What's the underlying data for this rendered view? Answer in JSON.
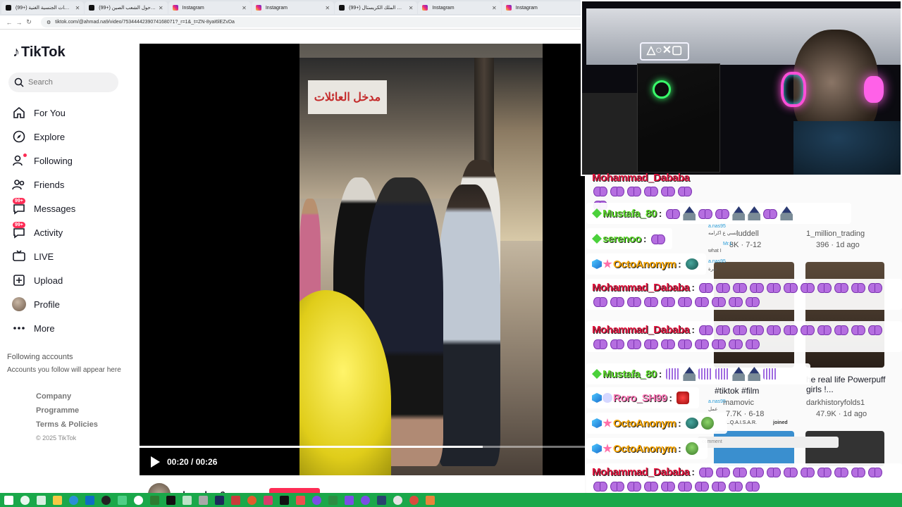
{
  "browser": {
    "tabs": [
      {
        "label": "(99+) السارسات الجنسية الغنية",
        "favicon": "tiktok"
      },
      {
        "label": "(99+) تحليلات حول الشعب الصين",
        "favicon": "tiktok"
      },
      {
        "label": "Instagram",
        "favicon": "instagram"
      },
      {
        "label": "Instagram",
        "favicon": "instagram"
      },
      {
        "label": "(99+) الملك الكريستال @rwafaa",
        "favicon": "tiktok"
      },
      {
        "label": "Instagram",
        "favicon": "instagram"
      },
      {
        "label": "Instagram",
        "favicon": "instagram"
      }
    ],
    "url": "tiktok.com/@ahmad.na9/video/7534444239074168071?_r=1&_t=ZN-8yaI6lEZvDa"
  },
  "tiktok": {
    "logo": "TikTok",
    "search_placeholder": "Search",
    "nav": [
      {
        "label": "For You",
        "icon": "home-icon"
      },
      {
        "label": "Explore",
        "icon": "compass-icon"
      },
      {
        "label": "Following",
        "icon": "person-follow-icon"
      },
      {
        "label": "Friends",
        "icon": "friends-icon"
      },
      {
        "label": "Messages",
        "icon": "messages-icon",
        "badge": "99+"
      },
      {
        "label": "Activity",
        "icon": "activity-icon",
        "badge": "99+"
      },
      {
        "label": "LIVE",
        "icon": "live-icon"
      },
      {
        "label": "Upload",
        "icon": "upload-icon"
      },
      {
        "label": "Profile",
        "icon": "profile-avatar"
      },
      {
        "label": "More",
        "icon": "more-icon"
      }
    ],
    "following_accounts_title": "Following accounts",
    "following_accounts_sub": "Accounts you follow will appear here",
    "footer": [
      "Company",
      "Programme",
      "Terms & Policies"
    ],
    "copyright": "© 2025 TikTok"
  },
  "video": {
    "sign_text": "مدخل العائلات",
    "time": "00:20 / 00:26",
    "progress": 0.77,
    "author": "ahmad.na9"
  },
  "behind": {
    "items": [
      {
        "text": "luddell",
        "sub": "8K · 7-12"
      },
      {
        "text": "1_million_trading",
        "sub": "396 · 1d ago"
      },
      {
        "text": "#tiktok #film",
        "sub": "mamovic"
      },
      {
        "text": "he real life Powerpuff girls !...",
        "sub": "darkhistoryfolds1"
      },
      {
        "text": "7.7K · 6-18",
        "sub": ""
      },
      {
        "text": "47.9K · 1d ago",
        "sub": ""
      }
    ],
    "comments": [
      {
        "user": "a.nas95",
        "text": "تسي ع اكرامه"
      },
      {
        "user": "Mr.L",
        "text": "what I"
      },
      {
        "user": "a.nas95",
        "text": "غبرة"
      },
      {
        "user": "a.nas95",
        "text": "عمل"
      }
    ],
    "joined": "L.Q.A.I.S.A.R.",
    "joined_label": "joined",
    "comment_placeholder": "comment"
  },
  "webcam": {
    "neon_sign": "△○✕▢"
  },
  "chat": [
    {
      "user": "Mohammad_Dababa",
      "color": "red",
      "badges": [],
      "emotes": [
        "bow",
        "bow",
        "bow",
        "bow",
        "bow",
        "bow",
        "bow"
      ],
      "partial": true
    },
    {
      "user": "Mustafa_80",
      "color": "green",
      "badges": [
        "diamond"
      ],
      "emotes": [
        "bow",
        "wiz",
        "bow",
        "bow",
        "wiz",
        "wiz",
        "bow",
        "wiz"
      ]
    },
    {
      "user": "serenoo",
      "color": "green",
      "badges": [
        "diamond"
      ],
      "emotes": [
        "bow"
      ]
    },
    {
      "user": "OctoAnonym",
      "color": "orange",
      "badges": [
        "cube",
        "star"
      ],
      "emotes": [
        "blob"
      ]
    },
    {
      "user": "Mohammad_Dababa",
      "color": "red",
      "badges": [],
      "emotes": [
        "bow",
        "bow",
        "bow",
        "bow",
        "bow",
        "bow",
        "bow",
        "bow",
        "bow",
        "bow",
        "bow",
        "bow",
        "bow",
        "bow",
        "bow",
        "bow",
        "bow",
        "bow",
        "bow",
        "bow",
        "bow"
      ]
    },
    {
      "user": "Mohammad_Dababa",
      "color": "red",
      "badges": [],
      "emotes": [
        "bow",
        "bow",
        "bow",
        "bow",
        "bow",
        "bow",
        "bow",
        "bow",
        "bow",
        "bow",
        "bow",
        "bow",
        "bow",
        "bow",
        "bow",
        "bow",
        "bow",
        "bow",
        "bow",
        "bow",
        "bow"
      ]
    },
    {
      "user": "Mustafa_80",
      "color": "green",
      "badges": [
        "diamond"
      ],
      "emotes": [
        "eq",
        "wiz",
        "eq",
        "eq",
        "wiz",
        "wiz",
        "eq"
      ]
    },
    {
      "user": "Roro_SH99",
      "color": "pink",
      "badges": [
        "cube",
        "gem"
      ],
      "emotes": [
        "red"
      ]
    },
    {
      "user": "OctoAnonym",
      "color": "orange",
      "badges": [
        "cube",
        "star"
      ],
      "emotes": [
        "blob",
        "frog"
      ]
    },
    {
      "user": "OctoAnonym",
      "color": "orange",
      "badges": [
        "cube",
        "star"
      ],
      "emotes": [
        "frog"
      ]
    },
    {
      "user": "Mohammad_Dababa",
      "color": "red",
      "badges": [],
      "emotes": [
        "bow",
        "bow",
        "bow",
        "bow",
        "bow",
        "bow",
        "bow",
        "bow",
        "bow",
        "bow",
        "bow",
        "bow",
        "bow",
        "bow",
        "bow",
        "bow",
        "bow",
        "bow",
        "bow",
        "bow",
        "bow"
      ]
    }
  ],
  "colors": {
    "tiktok_red": "#fe2c55",
    "taskbar": "#1aa84a"
  }
}
